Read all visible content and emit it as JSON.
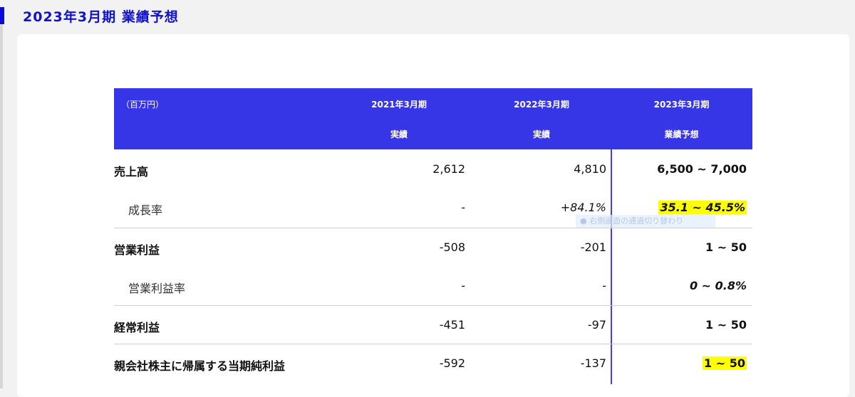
{
  "header": {
    "title": "2023年3月期 業績予想"
  },
  "table": {
    "unit_label": "（百万円）",
    "columns": [
      {
        "period": "2021年3月期",
        "type": "実績"
      },
      {
        "period": "2022年3月期",
        "type": "実績"
      },
      {
        "period": "2023年3月期",
        "type": "業績予想"
      }
    ],
    "rows": [
      {
        "label": "売上高",
        "v1": "2,612",
        "v2": "4,810",
        "v3": "6,500 ~ 7,000"
      },
      {
        "label": "成長率",
        "v1": "-",
        "v2": "+84.1%",
        "v3": "35.1 ~ 45.5%"
      },
      {
        "label": "営業利益",
        "v1": "-508",
        "v2": "-201",
        "v3": "1 ~ 50"
      },
      {
        "label": "営業利益率",
        "v1": "-",
        "v2": "-",
        "v3": "0 ~ 0.8%"
      },
      {
        "label": "経常利益",
        "v1": "-451",
        "v2": "-97",
        "v3": "1 ~ 50"
      },
      {
        "label": "親会社株主に帰属する当期純利益",
        "v1": "-592",
        "v2": "-137",
        "v3": "1 ~ 50"
      }
    ]
  },
  "overlay": {
    "text": "● 右側画面の通過切り替わり"
  },
  "colors": {
    "accent": "#3636e6",
    "title": "#1212c9",
    "highlight": "#ffff00"
  }
}
